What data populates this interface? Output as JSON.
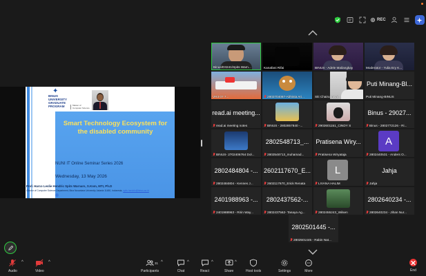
{
  "topbar": {
    "rec_label": "REC"
  },
  "slide": {
    "logo_lines": [
      "BINUS",
      "UNIVERSITY",
      "GRADUATE",
      "PROGRAM"
    ],
    "faculty_lines": [
      "Master of",
      "Computer Science"
    ],
    "title_line1": "Smart Technology Ecosystem for",
    "title_line2": "the disabled community",
    "series": "NUNI IT Online Seminar Series 2026",
    "date": "Wednesday, 13 May 2026",
    "speaker": "Prof. Harco Leslie Hendric Spits Warnars, S.Kom, MTI, Ph.D",
    "affiliation": "¹Doctor of Computer Science Department, Bina Nusantara University Jakarta 11480, Indonesia,",
    "email": "spits.hendric@binus.ac.id"
  },
  "gallery": {
    "tiles": [
      {
        "name": "Binus/D3241/Spits Warn...",
        "muted": false
      },
      {
        "name": "Kanafani Rifai",
        "muted": false
      },
      {
        "name": "BINUS - Adele Mailangkay",
        "muted": false
      },
      {
        "name": "Moderator - Yulia Ery K...",
        "muted": false
      },
      {
        "name": "VR3 07 7...",
        "muted": false
      },
      {
        "name": "2802704087-Abhista Ari...",
        "muted": true
      },
      {
        "name": "Siti Chairunnisah",
        "muted": false
      },
      {
        "name": "Puti Minang-BINUS",
        "big": "Puti Minang-Bl...",
        "muted": false
      },
      {
        "name": "read.ai meeting notes",
        "big": "read.ai meeting...",
        "muted": true
      },
      {
        "name": "BINUS - 2802857840 -...",
        "muted": true
      },
      {
        "name": "2902601151_CINDY S",
        "muted": true
      },
      {
        "name": "Binus - 2802772126 - Ri...",
        "big": "Binus - 29027...",
        "muted": true
      },
      {
        "name": "BINUS- 2702406764 Dol...",
        "muted": true
      },
      {
        "name": "2802548713_muhamad...",
        "big": "2802548713_...",
        "muted": true
      },
      {
        "name": "Pratisena Wiryataja",
        "big": "Pratisena Wiry...",
        "muted": true
      },
      {
        "name": "2802440531 - Anders O...",
        "avatar": "A",
        "muted": true
      },
      {
        "name": "2802484804 - Kennes J...",
        "big": "2802484804 -...",
        "muted": true
      },
      {
        "name": "2602117670_Erick Renata",
        "big": "2602117670_E...",
        "muted": true
      },
      {
        "name": "LIVANA HALIM",
        "avatar": "L",
        "muted": true
      },
      {
        "name": "Jahja",
        "big": "Jahja",
        "muted": true
      },
      {
        "name": "2401988963 - Ririn Way...",
        "big": "2401988963 -...",
        "muted": true
      },
      {
        "name": "2802437562- Tanaya Ag...",
        "big": "2802437562-...",
        "muted": true
      },
      {
        "name": "2802455243_Wilsen",
        "muted": true
      },
      {
        "name": "2802640234 - Jihan Nur...",
        "big": "2802640234 -...",
        "muted": true
      }
    ],
    "bottom_tile": {
      "name": "2802501445 - Rabin Nat...",
      "big": "2802501445 -..."
    }
  },
  "toolbar": {
    "audio": "Audio",
    "video": "Video",
    "participants": "Participants",
    "participants_count": "31",
    "chat": "Chat",
    "react": "React",
    "share": "Share",
    "host_tools": "Host tools",
    "settings": "Settings",
    "more": "More",
    "end": "End"
  },
  "colors": {
    "active_speaker": "#2ecc40",
    "avatar_A": "#5b3bc4",
    "avatar_L": "#8a8a8a",
    "end_red": "#e33333",
    "slide_title": "#fbe15c"
  }
}
